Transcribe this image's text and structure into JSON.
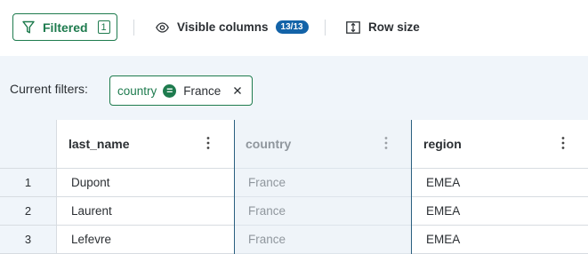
{
  "toolbar": {
    "filtered_label": "Filtered",
    "filtered_count": "1",
    "visible_columns_label": "Visible columns",
    "visible_columns_badge": "13/13",
    "row_size_label": "Row size"
  },
  "filters": {
    "label": "Current filters:",
    "chips": [
      {
        "field": "country",
        "operator": "=",
        "value": "France"
      }
    ]
  },
  "grid": {
    "columns": [
      "last_name",
      "country",
      "region"
    ],
    "selected_column": "country",
    "rows": [
      {
        "num": "1",
        "cells": [
          "Dupont",
          "France",
          "EMEA"
        ]
      },
      {
        "num": "2",
        "cells": [
          "Laurent",
          "France",
          "EMEA"
        ]
      },
      {
        "num": "3",
        "cells": [
          "Lefevre",
          "France",
          "EMEA"
        ]
      }
    ]
  },
  "colors": {
    "accent_green": "#1e7b4e",
    "badge_blue": "#1363a8",
    "selection_border": "#2a5f7f",
    "panel_bg": "#f0f5fa"
  },
  "icons": {
    "filter": "funnel-icon",
    "visible_columns": "eye-icon",
    "row_size": "row-height-icon",
    "chip_operator": "equals-icon",
    "chip_remove": "close-icon",
    "column_menu": "kebab-menu-icon"
  }
}
